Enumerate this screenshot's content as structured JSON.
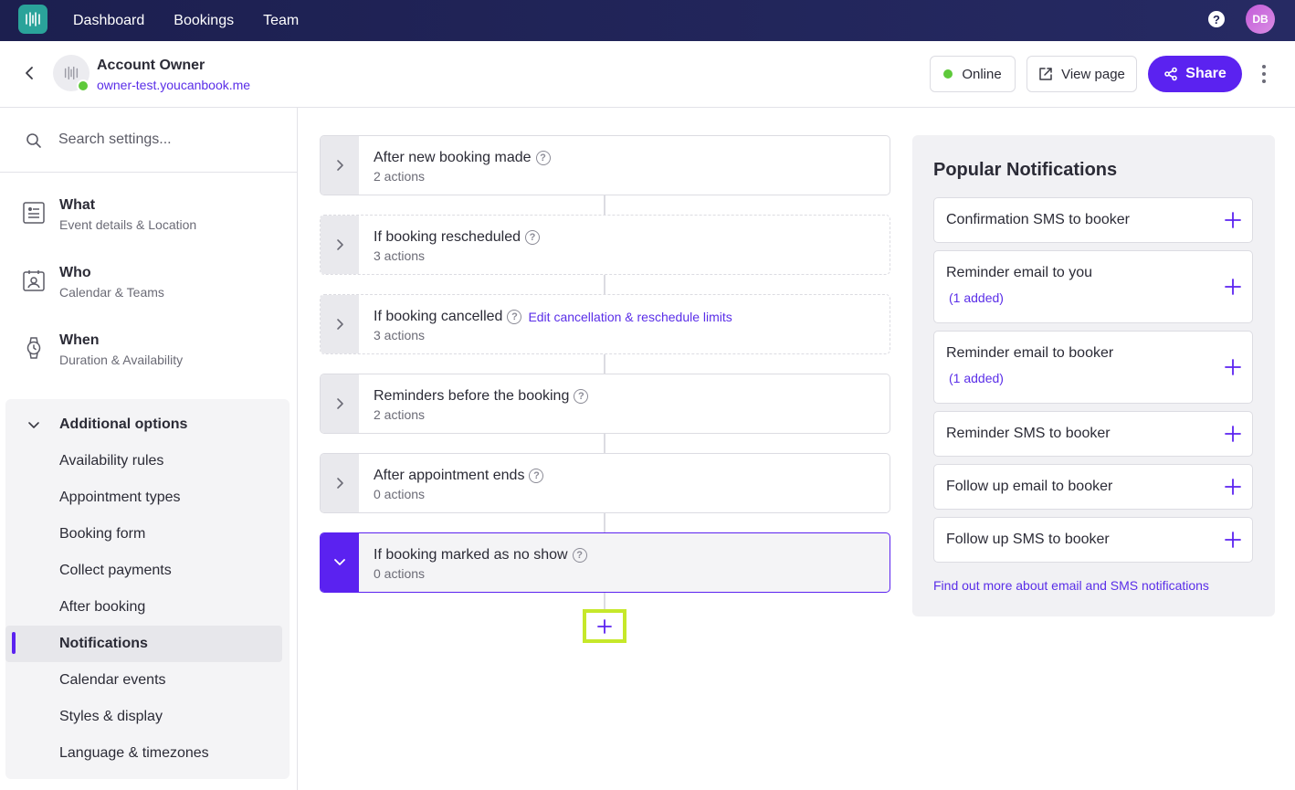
{
  "topnav": {
    "links": [
      "Dashboard",
      "Bookings",
      "Team"
    ],
    "help_icon": "?",
    "avatar_initials": "DB"
  },
  "header": {
    "account_name": "Account Owner",
    "account_url": "owner-test.youcanbook.me",
    "online_label": "Online",
    "view_page_label": "View page",
    "share_label": "Share",
    "colors": {
      "accent": "#5b22f0",
      "online": "#5ec93a"
    }
  },
  "sidebar": {
    "search_placeholder": "Search settings...",
    "sections": [
      {
        "title": "What",
        "subtitle": "Event details & Location",
        "icon": "document-icon"
      },
      {
        "title": "Who",
        "subtitle": "Calendar & Teams",
        "icon": "contact-card-icon"
      },
      {
        "title": "When",
        "subtitle": "Duration & Availability",
        "icon": "watch-icon"
      }
    ],
    "additional": {
      "title": "Additional options",
      "items": [
        "Availability rules",
        "Appointment types",
        "Booking form",
        "Collect payments",
        "After booking",
        "Notifications",
        "Calendar events",
        "Styles & display",
        "Language & timezones"
      ],
      "active": "Notifications"
    }
  },
  "triggers": [
    {
      "title": "After new booking made",
      "count": "2 actions"
    },
    {
      "title": "If booking rescheduled",
      "count": "3 actions"
    },
    {
      "title": "If booking cancelled",
      "count": "3 actions",
      "link": "Edit cancellation & reschedule limits"
    },
    {
      "title": "Reminders before the booking",
      "count": "2 actions"
    },
    {
      "title": "After appointment ends",
      "count": "0 actions"
    },
    {
      "title": "If booking marked as no show",
      "count": "0 actions"
    }
  ],
  "popular": {
    "title": "Popular Notifications",
    "items": [
      {
        "label": "Confirmation SMS to booker",
        "added": ""
      },
      {
        "label": "Reminder email to you",
        "added": "(1 added)"
      },
      {
        "label": "Reminder email to booker",
        "added": "(1 added)"
      },
      {
        "label": "Reminder SMS to booker",
        "added": ""
      },
      {
        "label": "Follow up email to booker",
        "added": ""
      },
      {
        "label": "Follow up SMS to booker",
        "added": ""
      }
    ],
    "footer_link": "Find out more about email and SMS notifications"
  }
}
